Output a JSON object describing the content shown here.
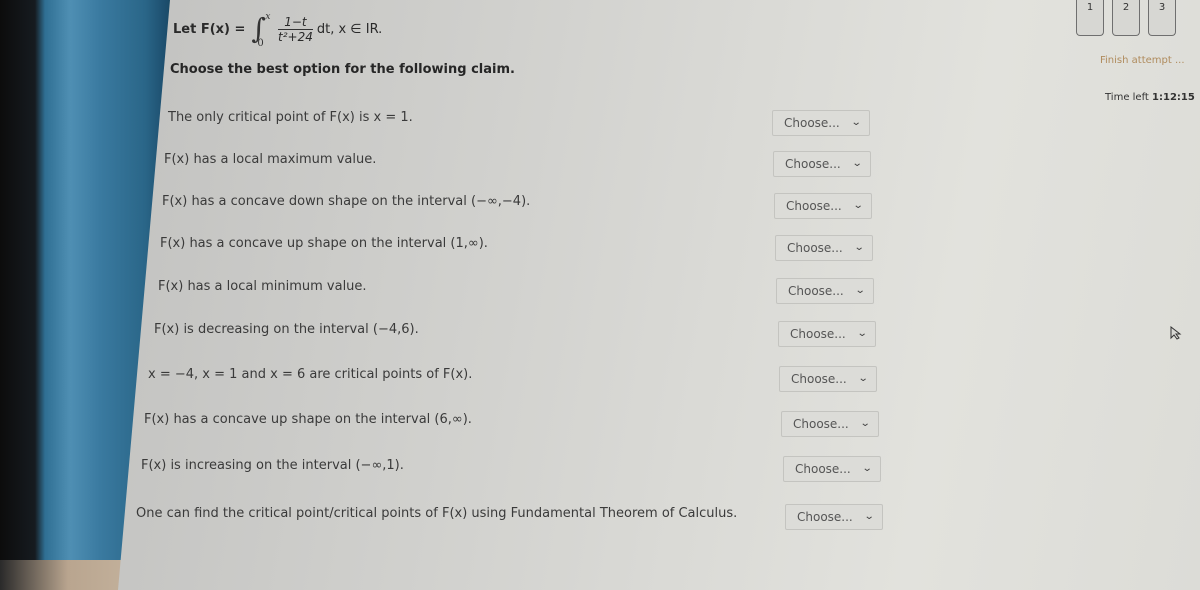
{
  "question": {
    "definition_label": "Let F(x) =",
    "integral_upper": "x",
    "integral_lower": "0",
    "integrand_numerator": "1−t",
    "integrand_denominator": "t²+24",
    "definition_tail": "dt, x ∈ IR.",
    "instruction": "Choose the best option for the following claim."
  },
  "claims": [
    {
      "text": "The only critical point of F(x) is x = 1.",
      "selected": "Choose..."
    },
    {
      "text": "F(x) has a local maximum value.",
      "selected": "Choose..."
    },
    {
      "text": "F(x) has a concave down shape on the interval (−∞,−4).",
      "selected": "Choose..."
    },
    {
      "text": "F(x) has a concave up shape on the interval (1,∞).",
      "selected": "Choose..."
    },
    {
      "text": "F(x) has a local minimum value.",
      "selected": "Choose..."
    },
    {
      "text": "F(x) is decreasing on the interval (−4,6).",
      "selected": "Choose..."
    },
    {
      "text": "x = −4, x = 1 and x = 6 are critical points of F(x).",
      "selected": "Choose..."
    },
    {
      "text": "F(x) has a concave up shape on the interval (6,∞).",
      "selected": "Choose..."
    },
    {
      "text": "F(x) is increasing on the interval (−∞,1).",
      "selected": "Choose..."
    },
    {
      "text": "One can find the critical point/critical points of F(x) using Fundamental Theorem of Calculus.",
      "selected": "Choose..."
    }
  ],
  "navigation": {
    "questions": [
      "1",
      "2",
      "3"
    ],
    "finish_label": "Finish attempt ...",
    "time_left_label": "Time left",
    "time_left_value": "1:12:15"
  },
  "colors": {
    "finish_link": "#b08c5e"
  }
}
